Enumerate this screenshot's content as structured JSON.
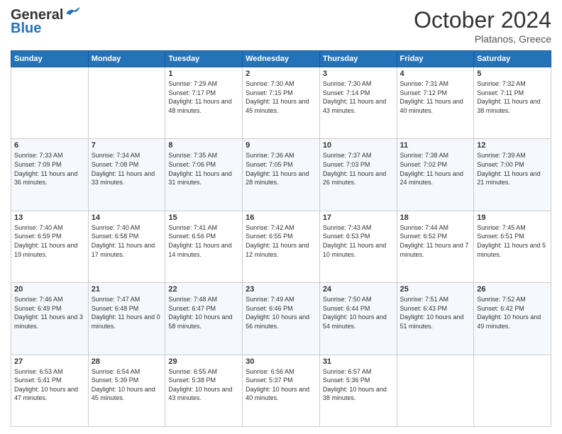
{
  "header": {
    "logo_general": "General",
    "logo_blue": "Blue",
    "month_title": "October 2024",
    "subtitle": "Platanos, Greece"
  },
  "days_of_week": [
    "Sunday",
    "Monday",
    "Tuesday",
    "Wednesday",
    "Thursday",
    "Friday",
    "Saturday"
  ],
  "weeks": [
    [
      {
        "day": "",
        "info": ""
      },
      {
        "day": "",
        "info": ""
      },
      {
        "day": "1",
        "info": "Sunrise: 7:29 AM\nSunset: 7:17 PM\nDaylight: 11 hours and 48 minutes."
      },
      {
        "day": "2",
        "info": "Sunrise: 7:30 AM\nSunset: 7:15 PM\nDaylight: 11 hours and 45 minutes."
      },
      {
        "day": "3",
        "info": "Sunrise: 7:30 AM\nSunset: 7:14 PM\nDaylight: 11 hours and 43 minutes."
      },
      {
        "day": "4",
        "info": "Sunrise: 7:31 AM\nSunset: 7:12 PM\nDaylight: 11 hours and 40 minutes."
      },
      {
        "day": "5",
        "info": "Sunrise: 7:32 AM\nSunset: 7:11 PM\nDaylight: 11 hours and 38 minutes."
      }
    ],
    [
      {
        "day": "6",
        "info": "Sunrise: 7:33 AM\nSunset: 7:09 PM\nDaylight: 11 hours and 36 minutes."
      },
      {
        "day": "7",
        "info": "Sunrise: 7:34 AM\nSunset: 7:08 PM\nDaylight: 11 hours and 33 minutes."
      },
      {
        "day": "8",
        "info": "Sunrise: 7:35 AM\nSunset: 7:06 PM\nDaylight: 11 hours and 31 minutes."
      },
      {
        "day": "9",
        "info": "Sunrise: 7:36 AM\nSunset: 7:05 PM\nDaylight: 11 hours and 28 minutes."
      },
      {
        "day": "10",
        "info": "Sunrise: 7:37 AM\nSunset: 7:03 PM\nDaylight: 11 hours and 26 minutes."
      },
      {
        "day": "11",
        "info": "Sunrise: 7:38 AM\nSunset: 7:02 PM\nDaylight: 11 hours and 24 minutes."
      },
      {
        "day": "12",
        "info": "Sunrise: 7:39 AM\nSunset: 7:00 PM\nDaylight: 11 hours and 21 minutes."
      }
    ],
    [
      {
        "day": "13",
        "info": "Sunrise: 7:40 AM\nSunset: 6:59 PM\nDaylight: 11 hours and 19 minutes."
      },
      {
        "day": "14",
        "info": "Sunrise: 7:40 AM\nSunset: 6:58 PM\nDaylight: 11 hours and 17 minutes."
      },
      {
        "day": "15",
        "info": "Sunrise: 7:41 AM\nSunset: 6:56 PM\nDaylight: 11 hours and 14 minutes."
      },
      {
        "day": "16",
        "info": "Sunrise: 7:42 AM\nSunset: 6:55 PM\nDaylight: 11 hours and 12 minutes."
      },
      {
        "day": "17",
        "info": "Sunrise: 7:43 AM\nSunset: 6:53 PM\nDaylight: 11 hours and 10 minutes."
      },
      {
        "day": "18",
        "info": "Sunrise: 7:44 AM\nSunset: 6:52 PM\nDaylight: 11 hours and 7 minutes."
      },
      {
        "day": "19",
        "info": "Sunrise: 7:45 AM\nSunset: 6:51 PM\nDaylight: 11 hours and 5 minutes."
      }
    ],
    [
      {
        "day": "20",
        "info": "Sunrise: 7:46 AM\nSunset: 6:49 PM\nDaylight: 11 hours and 3 minutes."
      },
      {
        "day": "21",
        "info": "Sunrise: 7:47 AM\nSunset: 6:48 PM\nDaylight: 11 hours and 0 minutes."
      },
      {
        "day": "22",
        "info": "Sunrise: 7:48 AM\nSunset: 6:47 PM\nDaylight: 10 hours and 58 minutes."
      },
      {
        "day": "23",
        "info": "Sunrise: 7:49 AM\nSunset: 6:46 PM\nDaylight: 10 hours and 56 minutes."
      },
      {
        "day": "24",
        "info": "Sunrise: 7:50 AM\nSunset: 6:44 PM\nDaylight: 10 hours and 54 minutes."
      },
      {
        "day": "25",
        "info": "Sunrise: 7:51 AM\nSunset: 6:43 PM\nDaylight: 10 hours and 51 minutes."
      },
      {
        "day": "26",
        "info": "Sunrise: 7:52 AM\nSunset: 6:42 PM\nDaylight: 10 hours and 49 minutes."
      }
    ],
    [
      {
        "day": "27",
        "info": "Sunrise: 6:53 AM\nSunset: 5:41 PM\nDaylight: 10 hours and 47 minutes."
      },
      {
        "day": "28",
        "info": "Sunrise: 6:54 AM\nSunset: 5:39 PM\nDaylight: 10 hours and 45 minutes."
      },
      {
        "day": "29",
        "info": "Sunrise: 6:55 AM\nSunset: 5:38 PM\nDaylight: 10 hours and 43 minutes."
      },
      {
        "day": "30",
        "info": "Sunrise: 6:56 AM\nSunset: 5:37 PM\nDaylight: 10 hours and 40 minutes."
      },
      {
        "day": "31",
        "info": "Sunrise: 6:57 AM\nSunset: 5:36 PM\nDaylight: 10 hours and 38 minutes."
      },
      {
        "day": "",
        "info": ""
      },
      {
        "day": "",
        "info": ""
      }
    ]
  ]
}
